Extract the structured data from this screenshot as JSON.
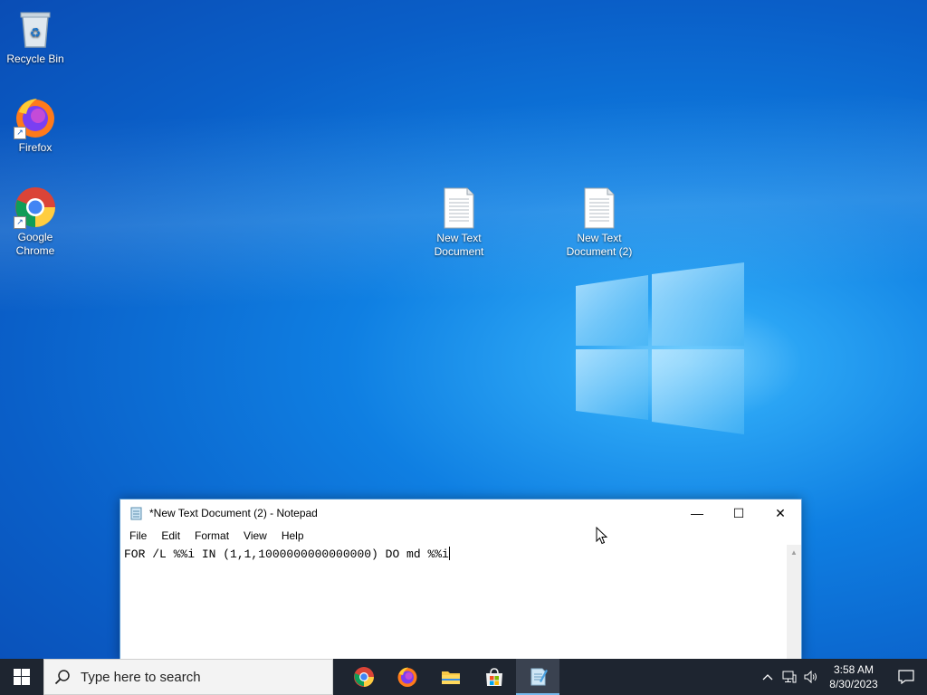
{
  "desktop": {
    "icons": [
      {
        "label": "Recycle Bin",
        "icon": "recycle-bin-icon"
      },
      {
        "label": "Firefox",
        "icon": "firefox-icon"
      },
      {
        "label": "Google Chrome",
        "icon": "chrome-icon"
      },
      {
        "label": "New Text Document",
        "icon": "text-document-icon"
      },
      {
        "label": "New Text Document (2)",
        "icon": "text-document-icon"
      }
    ]
  },
  "notepad": {
    "title": "*New Text Document (2) - Notepad",
    "menu": [
      "File",
      "Edit",
      "Format",
      "View",
      "Help"
    ],
    "content": "FOR /L %%i IN (1,1,1000000000000000) DO md %%i",
    "buttons": {
      "minimize": "—",
      "maximize": "☐",
      "close": "✕"
    }
  },
  "taskbar": {
    "search_placeholder": "Type here to search",
    "apps": [
      "chrome-icon",
      "firefox-icon",
      "file-explorer-icon",
      "microsoft-store-icon",
      "notepad-icon"
    ],
    "active_app": "notepad-icon",
    "clock": {
      "time": "3:58 AM",
      "date": "8/30/2023"
    }
  },
  "colors": {
    "taskbar_bg": "#1e2530",
    "desktop_accent": "#0f7fe2",
    "active_indicator": "#76b9ed"
  }
}
